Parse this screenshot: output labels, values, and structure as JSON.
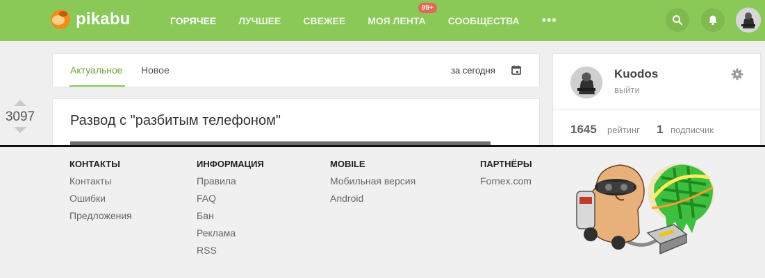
{
  "header": {
    "logo_text": "pikabu",
    "nav": [
      {
        "label": "ГОРЯЧЕЕ",
        "active": true
      },
      {
        "label": "ЛУЧШЕЕ",
        "active": false
      },
      {
        "label": "СВЕЖЕЕ",
        "active": false
      },
      {
        "label": "МОЯ ЛЕНТА",
        "active": false,
        "badge": "99+"
      },
      {
        "label": "СООБЩЕСТВА",
        "active": false
      }
    ],
    "more_label": "•••",
    "icons": [
      "search-icon",
      "bell-icon",
      "avatar"
    ]
  },
  "tabs": {
    "items": [
      "Актуальное",
      "Новое"
    ],
    "active": "Актуальное",
    "period": "за сегодня"
  },
  "post": {
    "score": "3097",
    "title": "Развод с \"разбитым телефоном\""
  },
  "profile": {
    "name": "Kuodos",
    "logout": "выйти",
    "rating_value": "1645",
    "rating_label": "рейтинг",
    "subscribers_value": "1",
    "subscribers_label": "подписчик"
  },
  "footer": {
    "columns": [
      {
        "title": "КОНТАКТЫ",
        "links": [
          "Контакты",
          "Ошибки",
          "Предложения"
        ]
      },
      {
        "title": "ИНФОРМАЦИЯ",
        "links": [
          "Правила",
          "FAQ",
          "Бан",
          "Реклама",
          "RSS"
        ]
      },
      {
        "title": "MOBILE",
        "links": [
          "Мобильная версия",
          "Android"
        ]
      },
      {
        "title": "ПАРТНЁРЫ",
        "links": [
          "Fornex.com"
        ]
      }
    ]
  },
  "colors": {
    "brand_green": "#8ac858",
    "badge_red": "#f2555a",
    "logo_orange": "#f08c1c"
  }
}
